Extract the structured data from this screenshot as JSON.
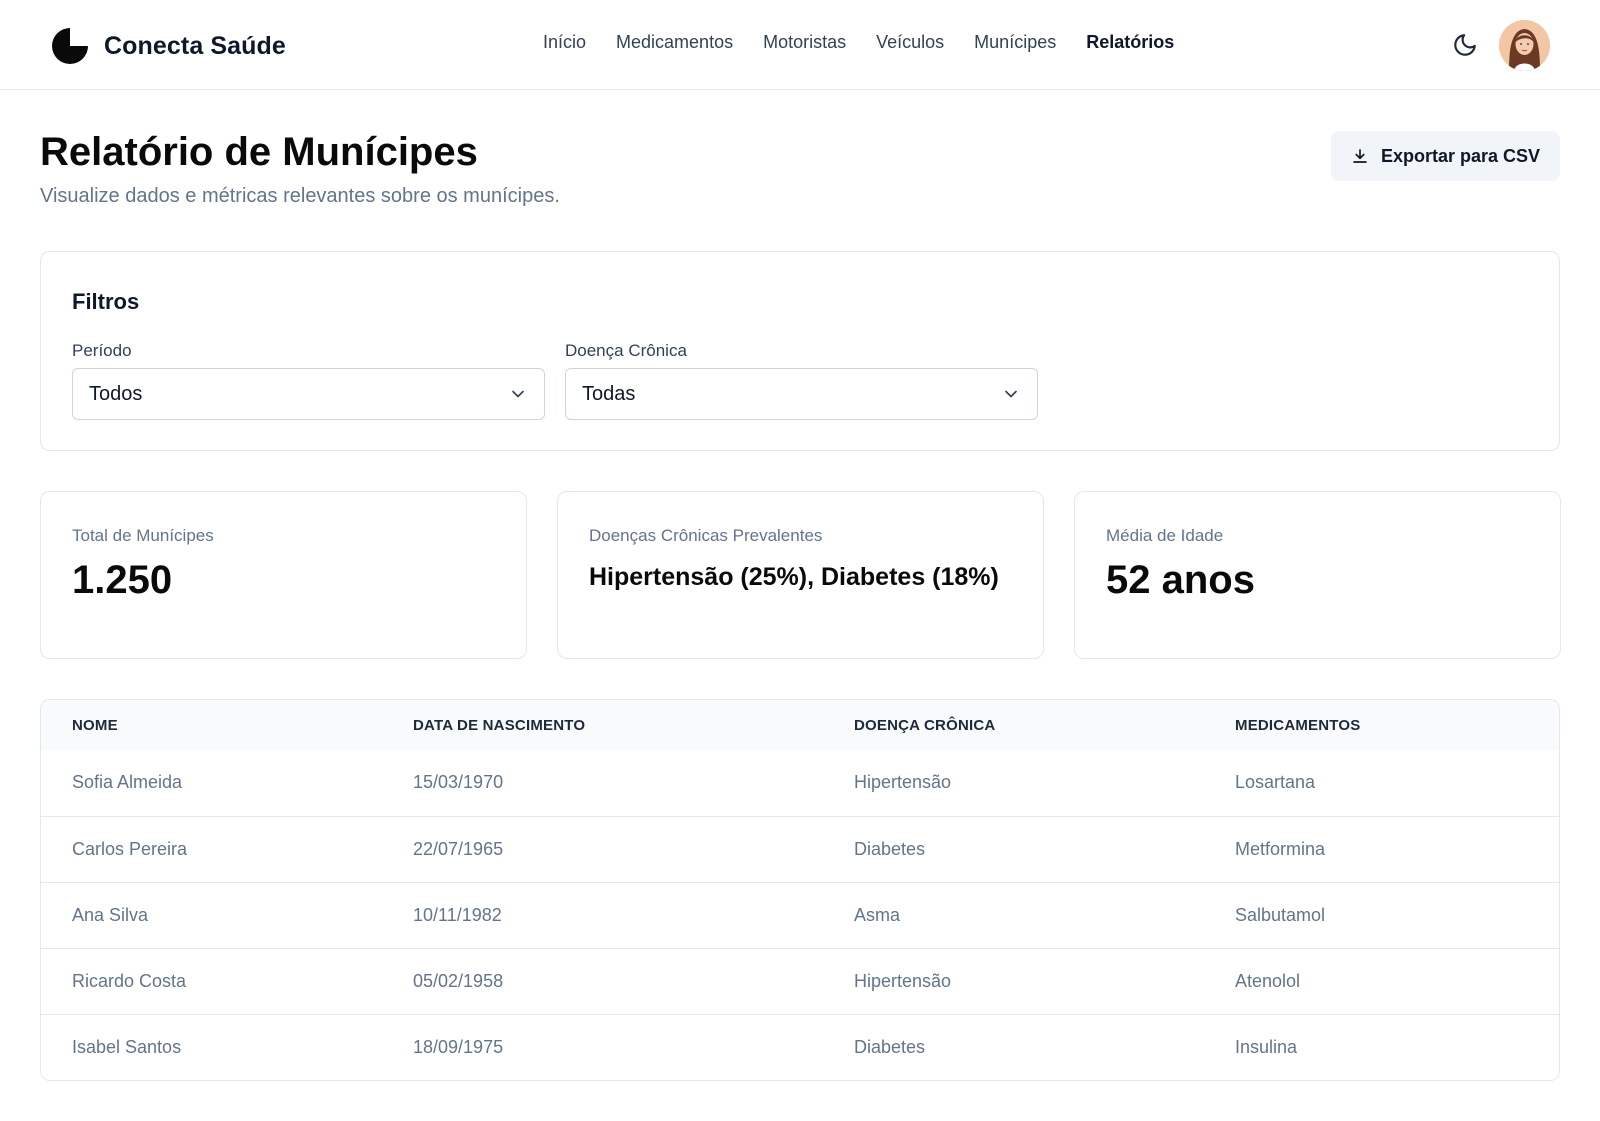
{
  "brand": {
    "name": "Conecta Saúde"
  },
  "nav": {
    "items": [
      {
        "label": "Início",
        "active": false
      },
      {
        "label": "Medicamentos",
        "active": false
      },
      {
        "label": "Motoristas",
        "active": false
      },
      {
        "label": "Veículos",
        "active": false
      },
      {
        "label": "Munícipes",
        "active": false
      },
      {
        "label": "Relatórios",
        "active": true
      }
    ]
  },
  "header_icons": {
    "theme": "moon-icon",
    "avatar": "user-avatar"
  },
  "page": {
    "title": "Relatório de Munícipes",
    "subtitle": "Visualize dados e métricas relevantes sobre os munícipes.",
    "export_label": "Exportar para CSV"
  },
  "filters": {
    "title": "Filtros",
    "periodo": {
      "label": "Período",
      "value": "Todos"
    },
    "doenca": {
      "label": "Doença Crônica",
      "value": "Todas"
    }
  },
  "metrics": [
    {
      "label": "Total de Munícipes",
      "value": "1.250"
    },
    {
      "label": "Doenças Crônicas Prevalentes",
      "value": "Hipertensão (25%), Diabetes (18%)"
    },
    {
      "label": "Média de Idade",
      "value": "52 anos"
    }
  ],
  "table": {
    "headers": [
      "NOME",
      "DATA DE NASCIMENTO",
      "DOENÇA CRÔNICA",
      "MEDICAMENTOS"
    ],
    "rows": [
      [
        "Sofia Almeida",
        "15/03/1970",
        "Hipertensão",
        "Losartana"
      ],
      [
        "Carlos Pereira",
        "22/07/1965",
        "Diabetes",
        "Metformina"
      ],
      [
        "Ana Silva",
        "10/11/1982",
        "Asma",
        "Salbutamol"
      ],
      [
        "Ricardo Costa",
        "05/02/1958",
        "Hipertensão",
        "Atenolol"
      ],
      [
        "Isabel Santos",
        "18/09/1975",
        "Diabetes",
        "Insulina"
      ]
    ]
  },
  "colors": {
    "text": "#0f172a",
    "muted": "#64748b",
    "border": "#e2e8f0",
    "button_bg": "#f1f5f9"
  }
}
